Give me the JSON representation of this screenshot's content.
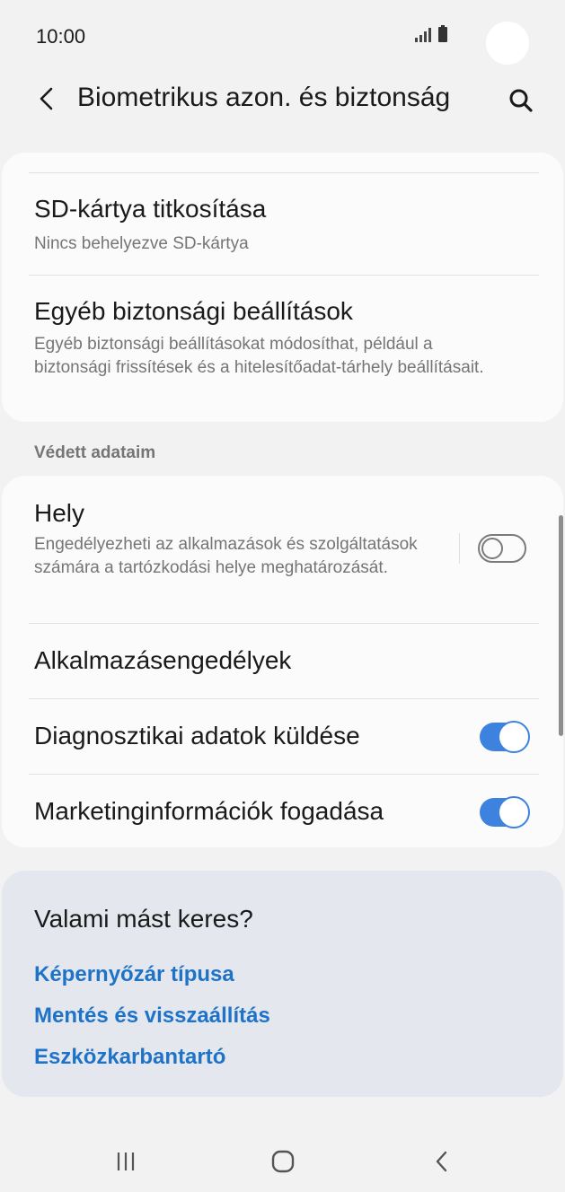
{
  "status_bar": {
    "time": "10:00"
  },
  "app_bar": {
    "title": "Biometrikus azon. és biztonság"
  },
  "card1": {
    "items": [
      {
        "title": "SD-kártya titkosítása",
        "subtitle": "Nincs behelyezve SD-kártya"
      },
      {
        "title": "Egyéb biztonsági beállítások",
        "subtitle": "Egyéb biztonsági beállításokat módosíthat, például a biztonsági frissítések és a hitelesítőadat-tárhely beállításait."
      }
    ]
  },
  "section_header": "Védett adataim",
  "card2": {
    "items": [
      {
        "title": "Hely",
        "subtitle": "Engedélyezheti az alkalmazások és szolgáltatások számára a tartózkodási helye meghatározását.",
        "toggle": false
      },
      {
        "title": "Alkalmazásengedélyek"
      },
      {
        "title": "Diagnosztikai adatok küldése",
        "toggle": true
      },
      {
        "title": "Marketinginformációk fogadása",
        "toggle": true
      }
    ]
  },
  "suggestions": {
    "title": "Valami mást keres?",
    "links": [
      "Képernyőzár típusa",
      "Mentés és visszaállítás",
      "Eszközkarbantartó"
    ]
  },
  "colors": {
    "accent": "#3e82e0",
    "link": "#1e73c8",
    "background": "#f2f2f2",
    "card": "#fbfbfb",
    "suggestion_card": "#e4e8ee"
  },
  "icons": {
    "back": "back-arrow-icon",
    "search": "search-icon",
    "signal": "signal-icon",
    "battery": "battery-icon",
    "nav_recents": "recents-icon",
    "nav_home": "home-icon",
    "nav_back": "nav-back-icon"
  }
}
